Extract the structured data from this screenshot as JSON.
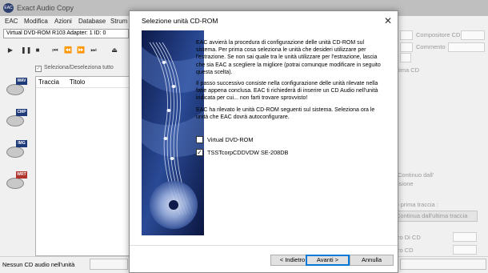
{
  "app": {
    "title": "Exact Audio Copy",
    "icon_label": "EAC",
    "menu": [
      "EAC",
      "Modifica",
      "Azioni",
      "Database",
      "Strum"
    ],
    "drive_selector": "Virtual DVD-ROM R103   Adapter: 1  ID: 0",
    "toolbar_icons": [
      "play-icon",
      "pause-icon",
      "stop-icon",
      "previous-track-icon",
      "rewind-icon",
      "fast-forward-icon",
      "next-track-icon",
      "eject-icon"
    ],
    "select_all_label": "Seleziona/Deseleziona tutto",
    "track_columns": [
      "Traccia",
      "Titolo"
    ],
    "side_buttons": [
      {
        "tag": "WAV",
        "name": "copy-wav-icon"
      },
      {
        "tag": "CMP",
        "name": "copy-compressed-icon"
      },
      {
        "tag": "IMG",
        "name": "copy-image-icon"
      },
      {
        "tag": "WRT",
        "name": "write-cd-icon"
      }
    ],
    "status_text": "Nessun CD audio nell'unità",
    "right_panel": {
      "composer_label": "Compositore CD",
      "comment_label": "Commento",
      "extra_cd_label": "tima CD",
      "continue_label_1": "Continuo dall'",
      "continue_label_2": "isione",
      "gap_label_1": "ro prima traccia :",
      "continue_last_track_button": "Continua dall'ultima traccia",
      "cd_number_label": "ro Di CD",
      "cd_label": "ro CD"
    }
  },
  "dialog": {
    "title": "Selezione unità CD-ROM",
    "close_glyph": "✕",
    "paragraphs": [
      "EAC avvierà la procedura di configurazione delle unità CD-ROM sul sistema. Per prima cosa seleziona le unità che desideri utilizzare per l'estrazione. Se non sai quale tra le unità utilizzare per l'estrazione, lascia che sia EAC a scegliere la migliore (potrai comunque modificare in seguito questa scelta).",
      "Il passo successivo consiste nella configurazione delle unità rilevate nella fase appena conclusa. EAC ti richiederà di inserire un CD Audio nell'unità indicata per cui... non farti trovare sprovvisto!",
      "EAC ha rilevato le unità CD-ROM seguenti sul sistema. Seleziona ora le unità che EAC dovrà autoconfigurare."
    ],
    "drives": [
      {
        "label": "Virtual DVD-ROM",
        "checked": false,
        "mark": ""
      },
      {
        "label": "TSSTcorpCDDVDW SE-208DB",
        "checked": true,
        "mark": "✓"
      }
    ],
    "buttons": {
      "back": "< Indietro",
      "next": "Avanti >",
      "cancel": "Annulla"
    }
  },
  "colors": {
    "banner_dark": "#0d1a4a",
    "banner_light": "#5c82c8",
    "accent": "#0078d7"
  }
}
